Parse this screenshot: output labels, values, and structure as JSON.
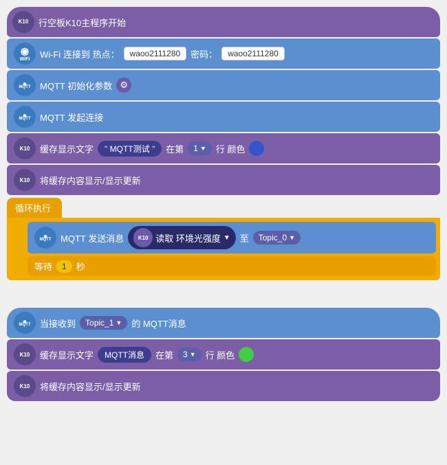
{
  "blocks": {
    "section1": {
      "block1": {
        "icon": "K10",
        "text": "行空板K10主程序开始"
      },
      "block2": {
        "icon": "WiFi",
        "text1": "Wi-Fi 连接到 热点：",
        "ssid": "waoo2111280",
        "text2": "密码：",
        "password": "waoo2111280"
      },
      "block3": {
        "icon": "MQTT",
        "text": "MQTT 初始化参数",
        "gear": "⚙"
      },
      "block4": {
        "icon": "MQTT",
        "text": "MQTT 发起连接"
      },
      "block5": {
        "icon": "K10",
        "text1": "缓存显示文字",
        "string": "MQTT测试",
        "text2": "在第",
        "row": "1",
        "text3": "行 颜色"
      },
      "block6": {
        "icon": "K10",
        "text": "将缓存内容显示/显示更新"
      },
      "loop": {
        "label": "循环执行",
        "inner": {
          "icon": "MQTT",
          "text1": "MQTT 发送消息",
          "k10sub": "K10",
          "text2": "读取  环境光强度",
          "text3": "至",
          "topic": "Topic_0"
        },
        "wait": {
          "text1": "等待",
          "num": "1",
          "text2": "秒"
        }
      }
    },
    "section2": {
      "block1": {
        "icon": "MQTT",
        "text1": "当接收到",
        "topic": "Topic_1",
        "text2": "的  MQTT消息"
      },
      "block2": {
        "icon": "K10",
        "text1": "缓存显示文字",
        "string": "MQTT消息",
        "text2": "在第",
        "row": "3",
        "text3": "行 颜色"
      },
      "block3": {
        "icon": "K10",
        "text": "将缓存内容显示/显示更新"
      }
    }
  }
}
